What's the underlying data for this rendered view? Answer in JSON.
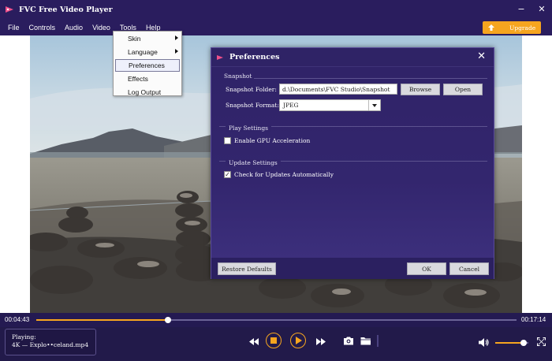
{
  "window": {
    "title": "FVC Free Video Player",
    "buttons": {
      "minimize": "−",
      "close": "✕"
    }
  },
  "menubar": {
    "items": [
      "File",
      "Controls",
      "Audio",
      "Video",
      "Tools",
      "Help"
    ],
    "active": "Tools",
    "upgrade_label": "Upgrade"
  },
  "tools_menu": {
    "items": [
      "Skin",
      "Language",
      "Preferences",
      "Effects",
      "Log Output"
    ],
    "submenu_items": [
      "Skin",
      "Language"
    ],
    "selected": "Preferences"
  },
  "preferences": {
    "title": "Preferences",
    "close_glyph": "✕",
    "snapshot": {
      "section": "Snapshot",
      "folder_label": "Snapshot Folder:",
      "folder_value": "d.\\Documents\\FVC Studio\\Snapshot",
      "browse_label": "Browse",
      "open_label": "Open",
      "format_label": "Snapshot Format:",
      "format_value": "JPEG"
    },
    "play": {
      "section": "Play Settings",
      "gpu_label": "Enable GPU Acceleration",
      "gpu_checked": false
    },
    "update": {
      "section": "Update Settings",
      "auto_label": "Check for Updates Automatically",
      "auto_checked": true,
      "check_glyph": "✓"
    },
    "footer": {
      "restore_label": "Restore Defaults",
      "ok_label": "OK",
      "cancel_label": "Cancel"
    }
  },
  "player": {
    "current_time": "00:04:43",
    "total_time": "00:17:14",
    "progress": 0.275,
    "volume": 0.85,
    "playing_label": "Playing:",
    "file_name": "4K — Explo••celand.mp4"
  },
  "colors": {
    "accent": "#f6a51f",
    "titlebar": "#2a1d5e",
    "dialog": "#2f2366"
  }
}
